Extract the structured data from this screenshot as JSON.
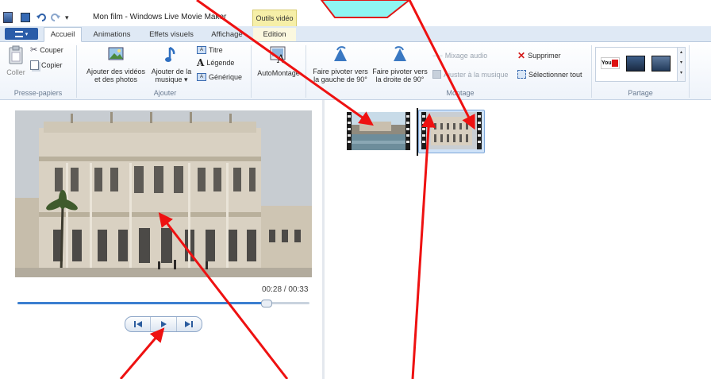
{
  "window": {
    "title": "Mon film - Windows Live Movie Maker",
    "context_tab_header": "Outils vidéo"
  },
  "tabs": [
    {
      "label": "Accueil",
      "active": true
    },
    {
      "label": "Animations"
    },
    {
      "label": "Effets visuels"
    },
    {
      "label": "Affichage"
    },
    {
      "label": "Edition",
      "contextual": true
    }
  ],
  "ribbon": {
    "clipboard": {
      "paste": "Coller",
      "cut": "Couper",
      "copy": "Copier",
      "group": "Presse-papiers"
    },
    "add": {
      "videos_line1": "Ajouter des vidéos",
      "videos_line2": "et des photos",
      "music_line1": "Ajouter de la",
      "music_line2": "musique ▾",
      "title": "Titre",
      "caption": "Légende",
      "credits": "Générique",
      "group": "Ajouter"
    },
    "automontage": "AutoMontage",
    "editing": {
      "rotate_left_line1": "Faire pivoter vers",
      "rotate_left_line2": "la gauche de 90°",
      "rotate_right_line1": "Faire pivoter vers",
      "rotate_right_line2": "la droite de 90°",
      "audio_mix": "Mixage audio",
      "fit_music": "Ajuster à la musique",
      "delete": "Supprimer",
      "select_all": "Sélectionner tout",
      "group": "Montage"
    },
    "share": {
      "group": "Partage",
      "youtube": "You"
    }
  },
  "player": {
    "time": "00:28 / 00:33",
    "progress": 0.85
  },
  "colors": {
    "annotation_arrow": "#ee1111",
    "accent": "#2a5ca8",
    "context_tab": "#f6efa8"
  }
}
